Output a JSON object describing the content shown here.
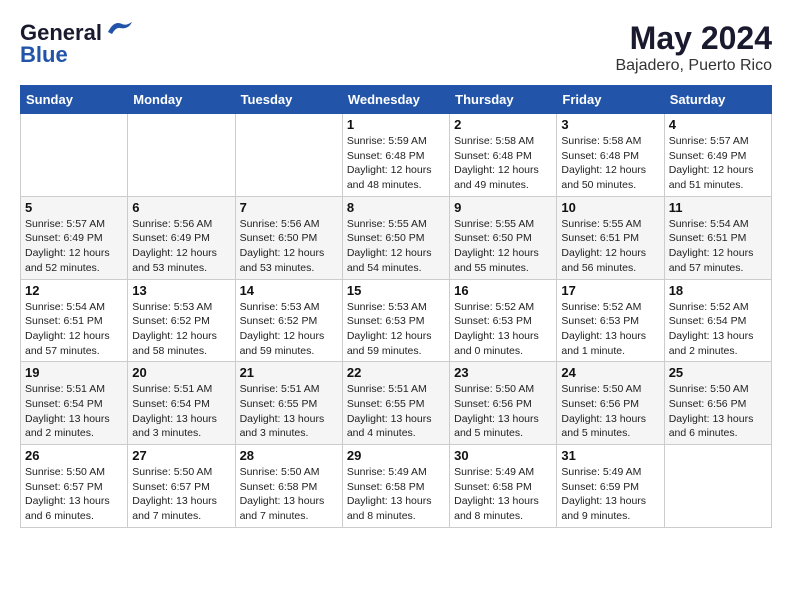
{
  "logo": {
    "general": "General",
    "blue": "Blue"
  },
  "title": {
    "month_year": "May 2024",
    "location": "Bajadero, Puerto Rico"
  },
  "headers": [
    "Sunday",
    "Monday",
    "Tuesday",
    "Wednesday",
    "Thursday",
    "Friday",
    "Saturday"
  ],
  "weeks": [
    [
      {
        "day": "",
        "info": ""
      },
      {
        "day": "",
        "info": ""
      },
      {
        "day": "",
        "info": ""
      },
      {
        "day": "1",
        "info": "Sunrise: 5:59 AM\nSunset: 6:48 PM\nDaylight: 12 hours\nand 48 minutes."
      },
      {
        "day": "2",
        "info": "Sunrise: 5:58 AM\nSunset: 6:48 PM\nDaylight: 12 hours\nand 49 minutes."
      },
      {
        "day": "3",
        "info": "Sunrise: 5:58 AM\nSunset: 6:48 PM\nDaylight: 12 hours\nand 50 minutes."
      },
      {
        "day": "4",
        "info": "Sunrise: 5:57 AM\nSunset: 6:49 PM\nDaylight: 12 hours\nand 51 minutes."
      }
    ],
    [
      {
        "day": "5",
        "info": "Sunrise: 5:57 AM\nSunset: 6:49 PM\nDaylight: 12 hours\nand 52 minutes."
      },
      {
        "day": "6",
        "info": "Sunrise: 5:56 AM\nSunset: 6:49 PM\nDaylight: 12 hours\nand 53 minutes."
      },
      {
        "day": "7",
        "info": "Sunrise: 5:56 AM\nSunset: 6:50 PM\nDaylight: 12 hours\nand 53 minutes."
      },
      {
        "day": "8",
        "info": "Sunrise: 5:55 AM\nSunset: 6:50 PM\nDaylight: 12 hours\nand 54 minutes."
      },
      {
        "day": "9",
        "info": "Sunrise: 5:55 AM\nSunset: 6:50 PM\nDaylight: 12 hours\nand 55 minutes."
      },
      {
        "day": "10",
        "info": "Sunrise: 5:55 AM\nSunset: 6:51 PM\nDaylight: 12 hours\nand 56 minutes."
      },
      {
        "day": "11",
        "info": "Sunrise: 5:54 AM\nSunset: 6:51 PM\nDaylight: 12 hours\nand 57 minutes."
      }
    ],
    [
      {
        "day": "12",
        "info": "Sunrise: 5:54 AM\nSunset: 6:51 PM\nDaylight: 12 hours\nand 57 minutes."
      },
      {
        "day": "13",
        "info": "Sunrise: 5:53 AM\nSunset: 6:52 PM\nDaylight: 12 hours\nand 58 minutes."
      },
      {
        "day": "14",
        "info": "Sunrise: 5:53 AM\nSunset: 6:52 PM\nDaylight: 12 hours\nand 59 minutes."
      },
      {
        "day": "15",
        "info": "Sunrise: 5:53 AM\nSunset: 6:53 PM\nDaylight: 12 hours\nand 59 minutes."
      },
      {
        "day": "16",
        "info": "Sunrise: 5:52 AM\nSunset: 6:53 PM\nDaylight: 13 hours\nand 0 minutes."
      },
      {
        "day": "17",
        "info": "Sunrise: 5:52 AM\nSunset: 6:53 PM\nDaylight: 13 hours\nand 1 minute."
      },
      {
        "day": "18",
        "info": "Sunrise: 5:52 AM\nSunset: 6:54 PM\nDaylight: 13 hours\nand 2 minutes."
      }
    ],
    [
      {
        "day": "19",
        "info": "Sunrise: 5:51 AM\nSunset: 6:54 PM\nDaylight: 13 hours\nand 2 minutes."
      },
      {
        "day": "20",
        "info": "Sunrise: 5:51 AM\nSunset: 6:54 PM\nDaylight: 13 hours\nand 3 minutes."
      },
      {
        "day": "21",
        "info": "Sunrise: 5:51 AM\nSunset: 6:55 PM\nDaylight: 13 hours\nand 3 minutes."
      },
      {
        "day": "22",
        "info": "Sunrise: 5:51 AM\nSunset: 6:55 PM\nDaylight: 13 hours\nand 4 minutes."
      },
      {
        "day": "23",
        "info": "Sunrise: 5:50 AM\nSunset: 6:56 PM\nDaylight: 13 hours\nand 5 minutes."
      },
      {
        "day": "24",
        "info": "Sunrise: 5:50 AM\nSunset: 6:56 PM\nDaylight: 13 hours\nand 5 minutes."
      },
      {
        "day": "25",
        "info": "Sunrise: 5:50 AM\nSunset: 6:56 PM\nDaylight: 13 hours\nand 6 minutes."
      }
    ],
    [
      {
        "day": "26",
        "info": "Sunrise: 5:50 AM\nSunset: 6:57 PM\nDaylight: 13 hours\nand 6 minutes."
      },
      {
        "day": "27",
        "info": "Sunrise: 5:50 AM\nSunset: 6:57 PM\nDaylight: 13 hours\nand 7 minutes."
      },
      {
        "day": "28",
        "info": "Sunrise: 5:50 AM\nSunset: 6:58 PM\nDaylight: 13 hours\nand 7 minutes."
      },
      {
        "day": "29",
        "info": "Sunrise: 5:49 AM\nSunset: 6:58 PM\nDaylight: 13 hours\nand 8 minutes."
      },
      {
        "day": "30",
        "info": "Sunrise: 5:49 AM\nSunset: 6:58 PM\nDaylight: 13 hours\nand 8 minutes."
      },
      {
        "day": "31",
        "info": "Sunrise: 5:49 AM\nSunset: 6:59 PM\nDaylight: 13 hours\nand 9 minutes."
      },
      {
        "day": "",
        "info": ""
      }
    ]
  ]
}
